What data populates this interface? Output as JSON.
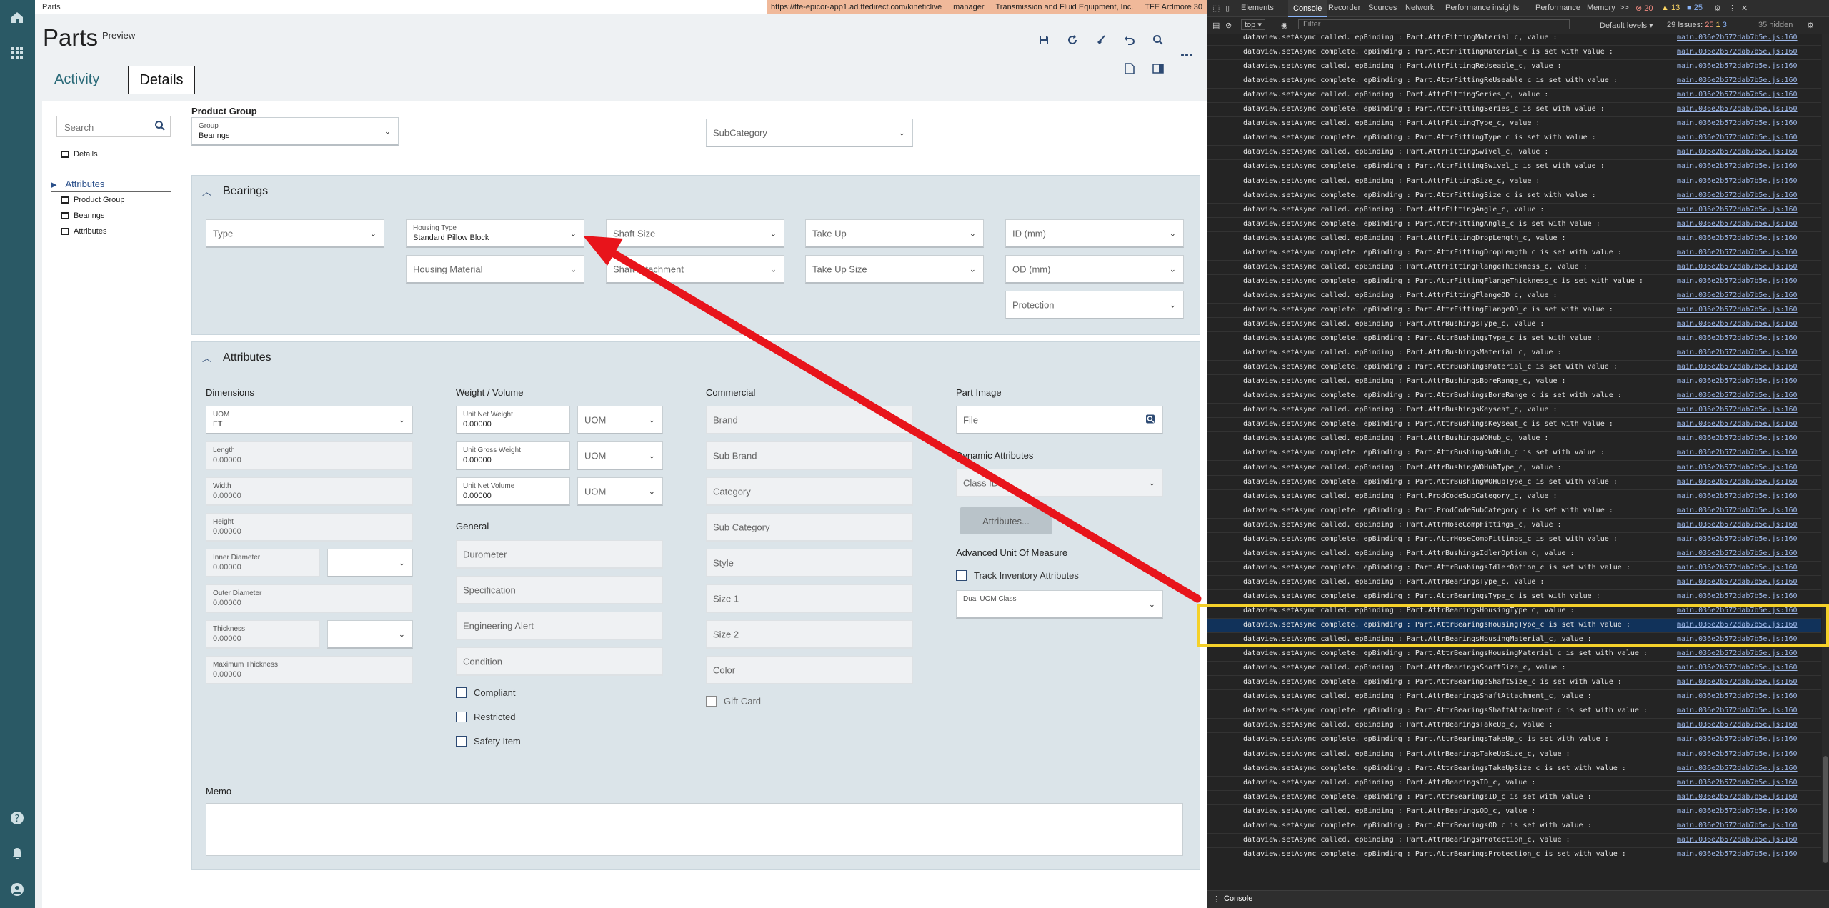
{
  "breadcrumb": "Parts",
  "env": {
    "url": "https://tfe-epicor-app1.ad.tfedirect.com/kineticlive",
    "user": "manager",
    "company": "Transmission and Fluid Equipment, Inc.",
    "site": "TFE Ardmore 30"
  },
  "page": {
    "title": "Parts",
    "badge": "Preview"
  },
  "tabs": {
    "activity": "Activity",
    "details": "Details"
  },
  "search": {
    "placeholder": "Search"
  },
  "nav": {
    "details": "Details",
    "attributes": "Attributes",
    "children": [
      "Product Group",
      "Bearings",
      "Attributes"
    ]
  },
  "product_group": {
    "heading": "Product Group",
    "group_label": "Group",
    "group_value": "Bearings",
    "subcategory": "SubCategory"
  },
  "bearings": {
    "title": "Bearings",
    "type": "Type",
    "housing_type_label": "Housing Type",
    "housing_type_value": "Standard Pillow Block",
    "shaft_size": "Shaft Size",
    "take_up": "Take Up",
    "id_mm": "ID (mm)",
    "housing_material": "Housing Material",
    "shaft_attachment": "Shaft Attachment",
    "take_up_size": "Take Up Size",
    "od_mm": "OD (mm)",
    "protection": "Protection"
  },
  "attributes": {
    "title": "Attributes",
    "dimensions": {
      "heading": "Dimensions",
      "uom_label": "UOM",
      "uom_value": "FT",
      "length": "Length",
      "width": "Width",
      "height": "Height",
      "inner_diameter": "Inner Diameter",
      "outer_diameter": "Outer Diameter",
      "thickness": "Thickness",
      "max_thickness": "Maximum Thickness",
      "zero": "0.00000"
    },
    "weight": {
      "heading": "Weight / Volume",
      "net_weight": "Unit Net Weight",
      "gross_weight": "Unit Gross Weight",
      "net_volume": "Unit Net Volume",
      "zero": "0.00000",
      "uom": "UOM"
    },
    "general": {
      "heading": "General",
      "durometer": "Durometer",
      "specification": "Specification",
      "engineering_alert": "Engineering Alert",
      "condition": "Condition",
      "compliant": "Compliant",
      "restricted": "Restricted",
      "safety_item": "Safety Item"
    },
    "commercial": {
      "heading": "Commercial",
      "brand": "Brand",
      "sub_brand": "Sub Brand",
      "category": "Category",
      "sub_category": "Sub Category",
      "style": "Style",
      "size1": "Size 1",
      "size2": "Size 2",
      "color": "Color",
      "gift_card": "Gift Card"
    },
    "part_image": {
      "heading": "Part Image",
      "file": "File"
    },
    "dynamic": {
      "heading": "Dynamic Attributes",
      "class_id": "Class ID",
      "button": "Attributes..."
    },
    "auom": {
      "heading": "Advanced Unit Of Measure",
      "track": "Track Inventory Attributes",
      "dual": "Dual UOM Class"
    },
    "memo": "Memo"
  },
  "devtools": {
    "tabs": [
      "Elements",
      "Console",
      "Recorder",
      "Sources",
      "Network",
      "Performance insights",
      "Performance",
      "Memory"
    ],
    "active_tab": "Console",
    "more": ">>",
    "badges": [
      "20",
      "13",
      "25"
    ],
    "context": "top",
    "filter": "Filter",
    "levels": "Default levels",
    "issues_label": "29 Issues:",
    "issues": [
      "25",
      "1",
      "3"
    ],
    "hidden": "35 hidden",
    "bottom_tab": "Console",
    "source": "main.036e2b572dab7b5e.js:160",
    "rows": [
      "dataview.setAsync called. epBinding : Part.AttrFittingMaterial_c, value :",
      "dataview.setAsync complete. epBinding : Part.AttrFittingMaterial_c is set with value :",
      "dataview.setAsync called. epBinding : Part.AttrFittingReUseable_c, value :",
      "dataview.setAsync complete. epBinding : Part.AttrFittingReUseable_c is set with value :",
      "dataview.setAsync called. epBinding : Part.AttrFittingSeries_c, value :",
      "dataview.setAsync complete. epBinding : Part.AttrFittingSeries_c is set with value :",
      "dataview.setAsync called. epBinding : Part.AttrFittingType_c, value :",
      "dataview.setAsync complete. epBinding : Part.AttrFittingType_c is set with value :",
      "dataview.setAsync called. epBinding : Part.AttrFittingSwivel_c, value :",
      "dataview.setAsync complete. epBinding : Part.AttrFittingSwivel_c is set with value :",
      "dataview.setAsync called. epBinding : Part.AttrFittingSize_c, value :",
      "dataview.setAsync complete. epBinding : Part.AttrFittingSize_c is set with value :",
      "dataview.setAsync called. epBinding : Part.AttrFittingAngle_c, value :",
      "dataview.setAsync complete. epBinding : Part.AttrFittingAngle_c is set with value :",
      "dataview.setAsync called. epBinding : Part.AttrFittingDropLength_c, value :",
      "dataview.setAsync complete. epBinding : Part.AttrFittingDropLength_c is set with value :",
      "dataview.setAsync called. epBinding : Part.AttrFittingFlangeThickness_c, value :",
      "dataview.setAsync complete. epBinding : Part.AttrFittingFlangeThickness_c is set with value :",
      "dataview.setAsync called. epBinding : Part.AttrFittingFlangeOD_c, value :",
      "dataview.setAsync complete. epBinding : Part.AttrFittingFlangeOD_c is set with value :",
      "dataview.setAsync called. epBinding : Part.AttrBushingsType_c, value :",
      "dataview.setAsync complete. epBinding : Part.AttrBushingsType_c is set with value :",
      "dataview.setAsync called. epBinding : Part.AttrBushingsMaterial_c, value :",
      "dataview.setAsync complete. epBinding : Part.AttrBushingsMaterial_c is set with value :",
      "dataview.setAsync called. epBinding : Part.AttrBushingsBoreRange_c, value :",
      "dataview.setAsync complete. epBinding : Part.AttrBushingsBoreRange_c is set with value :",
      "dataview.setAsync called. epBinding : Part.AttrBushingsKeyseat_c, value :",
      "dataview.setAsync complete. epBinding : Part.AttrBushingsKeyseat_c is set with value :",
      "dataview.setAsync called. epBinding : Part.AttrBushingsWOHub_c, value :",
      "dataview.setAsync complete. epBinding : Part.AttrBushingsWOHub_c is set with value :",
      "dataview.setAsync called. epBinding : Part.AttrBushingWOHubType_c, value :",
      "dataview.setAsync complete. epBinding : Part.AttrBushingWOHubType_c is set with value :",
      "dataview.setAsync called. epBinding : Part.ProdCodeSubCategory_c, value :",
      "dataview.setAsync complete. epBinding : Part.ProdCodeSubCategory_c is set with value :",
      "dataview.setAsync called. epBinding : Part.AttrHoseCompFittings_c, value :",
      "dataview.setAsync complete. epBinding : Part.AttrHoseCompFittings_c is set with value :",
      "dataview.setAsync called. epBinding : Part.AttrBushingsIdlerOption_c, value :",
      "dataview.setAsync complete. epBinding : Part.AttrBushingsIdlerOption_c is set with value :",
      "dataview.setAsync called. epBinding : Part.AttrBearingsType_c, value :",
      "dataview.setAsync complete. epBinding : Part.AttrBearingsType_c is set with value :",
      "dataview.setAsync called. epBinding : Part.AttrBearingsHousingType_c, value :",
      "dataview.setAsync complete. epBinding : Part.AttrBearingsHousingType_c is set with value :",
      "dataview.setAsync called. epBinding : Part.AttrBearingsHousingMaterial_c, value :",
      "dataview.setAsync complete. epBinding : Part.AttrBearingsHousingMaterial_c is set with value :",
      "dataview.setAsync called. epBinding : Part.AttrBearingsShaftSize_c, value :",
      "dataview.setAsync complete. epBinding : Part.AttrBearingsShaftSize_c is set with value :",
      "dataview.setAsync called. epBinding : Part.AttrBearingsShaftAttachment_c, value :",
      "dataview.setAsync complete. epBinding : Part.AttrBearingsShaftAttachment_c is set with value :",
      "dataview.setAsync called. epBinding : Part.AttrBearingsTakeUp_c, value :",
      "dataview.setAsync complete. epBinding : Part.AttrBearingsTakeUp_c is set with value :",
      "dataview.setAsync called. epBinding : Part.AttrBearingsTakeUpSize_c, value :",
      "dataview.setAsync complete. epBinding : Part.AttrBearingsTakeUpSize_c is set with value :",
      "dataview.setAsync called. epBinding : Part.AttrBearingsID_c, value :",
      "dataview.setAsync complete. epBinding : Part.AttrBearingsID_c is set with value :",
      "dataview.setAsync called. epBinding : Part.AttrBearingsOD_c, value :",
      "dataview.setAsync complete. epBinding : Part.AttrBearingsOD_c is set with value :",
      "dataview.setAsync called. epBinding : Part.AttrBearingsProtection_c, value :",
      "dataview.setAsync complete. epBinding : Part.AttrBearingsProtection_c is set with value :"
    ],
    "selected_row": 41
  },
  "colors": {
    "rail": "#2a5965",
    "env_bar": "#f0b99a",
    "annotation_arrow": "#e8141b",
    "highlight_box": "#f5d12a",
    "selected_row": "#11325a"
  }
}
